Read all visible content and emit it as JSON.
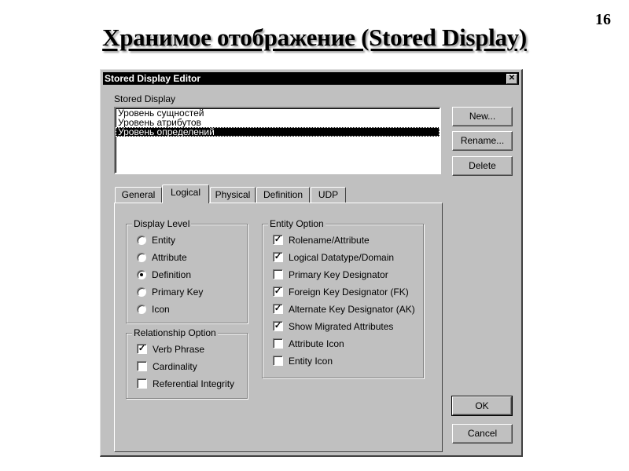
{
  "slide": {
    "number": "16",
    "title": "Хранимое отображение (Stored Display)"
  },
  "dialog": {
    "title": "Stored Display Editor",
    "close_glyph": "✕",
    "stored_display_label": "Stored Display",
    "list": [
      {
        "label": "Уровень сущностей",
        "selected": false
      },
      {
        "label": "Уровень атрибутов",
        "selected": false
      },
      {
        "label": "Уровень определений",
        "selected": true
      }
    ],
    "buttons": {
      "new": "New...",
      "rename": "Rename...",
      "delete": "Delete",
      "ok": "OK",
      "cancel": "Cancel"
    },
    "tabs": [
      {
        "label": "General",
        "active": false
      },
      {
        "label": "Logical",
        "active": true
      },
      {
        "label": "Physical",
        "active": false
      },
      {
        "label": "Definition",
        "active": false
      },
      {
        "label": "UDP",
        "active": false
      }
    ],
    "display_level": {
      "title": "Display Level",
      "options": [
        {
          "label": "Entity",
          "checked": false
        },
        {
          "label": "Attribute",
          "checked": false
        },
        {
          "label": "Definition",
          "checked": true
        },
        {
          "label": "Primary Key",
          "checked": false
        },
        {
          "label": "Icon",
          "checked": false
        }
      ]
    },
    "relationship_option": {
      "title": "Relationship Option",
      "options": [
        {
          "label": "Verb Phrase",
          "checked": true
        },
        {
          "label": "Cardinality",
          "checked": false
        },
        {
          "label": "Referential Integrity",
          "checked": false
        }
      ]
    },
    "entity_option": {
      "title": "Entity Option",
      "options": [
        {
          "label": "Rolename/Attribute",
          "checked": true
        },
        {
          "label": "Logical Datatype/Domain",
          "checked": true
        },
        {
          "label": "Primary Key Designator",
          "checked": false
        },
        {
          "label": "Foreign Key Designator (FK)",
          "checked": true
        },
        {
          "label": "Alternate Key Designator (AK)",
          "checked": true
        },
        {
          "label": "Show Migrated Attributes",
          "checked": true
        },
        {
          "label": "Attribute Icon",
          "checked": false
        },
        {
          "label": "Entity Icon",
          "checked": false
        }
      ]
    }
  }
}
